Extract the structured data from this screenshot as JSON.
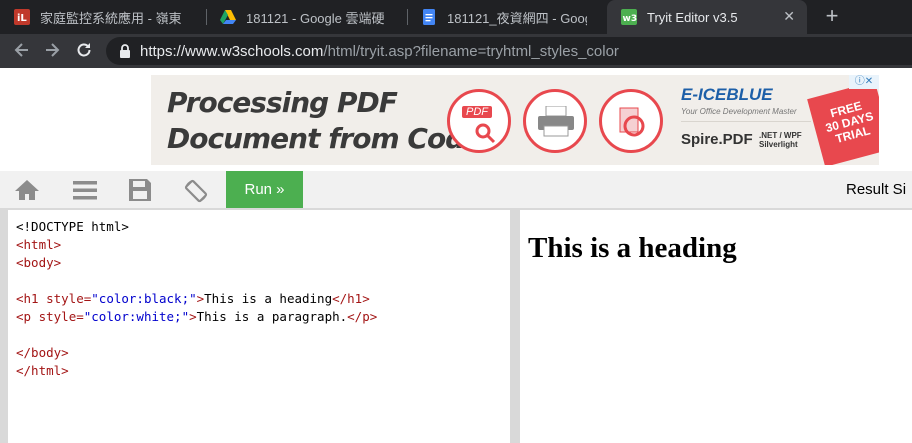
{
  "browser": {
    "tabs": [
      {
        "title": "家庭監控系統應用 - 嶺東",
        "active": false
      },
      {
        "title": "181121 - Google 雲端硬",
        "active": false
      },
      {
        "title": "181121_夜資網四 - Goog",
        "active": false
      },
      {
        "title": "Tryit Editor v3.5",
        "active": true
      }
    ],
    "new_tab": "+",
    "close_glyph": "✕",
    "url_host": "https://www.w3schools.com",
    "url_rest": "/html/tryit.asp?filename=tryhtml_styles_color"
  },
  "ad": {
    "headline_1": "Processing PDF",
    "headline_2": "Document from Code",
    "pdf_tag": "PDF",
    "brand": "E-ICEBLUE",
    "brand_tagline": "Your Office Development Master",
    "product": "Spire.PDF",
    "product_platforms_1": ".NET / WPF",
    "product_platforms_2": "Silverlight",
    "promo_1": "FREE",
    "promo_2": "30 DAYS",
    "promo_3": "TRIAL"
  },
  "toolbar": {
    "run_label": "Run »",
    "result_label": "Result Si"
  },
  "editor": {
    "lines": {
      "l1": "<!DOCTYPE html>",
      "l2_tag": "<html>",
      "l3_tag": "<body>",
      "l5_open": "<h1",
      "l5_attr": " style=",
      "l5_str": "\"color:black;\"",
      "l5_close": ">",
      "l5_text": "This is a heading",
      "l5_end": "</h1>",
      "l6_open": "<p",
      "l6_attr": " style=",
      "l6_str": "\"color:white;\"",
      "l6_close": ">",
      "l6_text": "This is a paragraph.",
      "l6_end": "</p>",
      "l8_tag": "</body>",
      "l9_tag": "</html>"
    }
  },
  "result": {
    "heading": "This is a heading"
  },
  "colors": {
    "run_button": "#4caf50",
    "tag_color": "#a31515",
    "string_color": "#0000cd"
  }
}
